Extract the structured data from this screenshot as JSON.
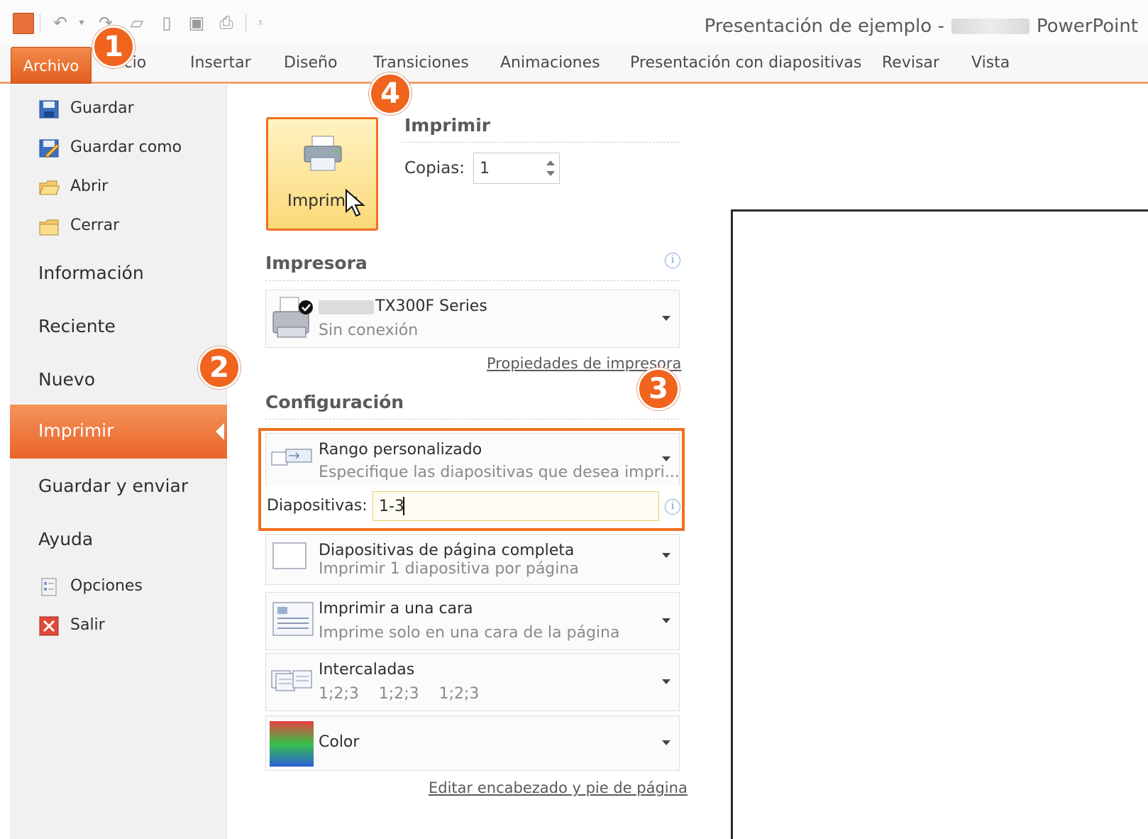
{
  "window": {
    "title_left": "Presentación de ejemplo  -",
    "title_right": "PowerPoint"
  },
  "ribbon": {
    "file_tab": "Archivo",
    "tabs": [
      "Inicio",
      "Insertar",
      "Diseño",
      "Transiciones",
      "Animaciones",
      "Presentación con diapositivas",
      "Revisar",
      "Vista"
    ]
  },
  "nav": {
    "save": "Guardar",
    "save_as": "Guardar como",
    "open": "Abrir",
    "close": "Cerrar",
    "info": "Información",
    "recent": "Reciente",
    "new": "Nuevo",
    "print": "Imprimir",
    "save_send": "Guardar y enviar",
    "help": "Ayuda",
    "options": "Opciones",
    "exit": "Salir"
  },
  "print": {
    "button_label": "Imprimir",
    "section_title": "Imprimir",
    "copies_label": "Copias:",
    "copies_value": "1"
  },
  "printer": {
    "section_title": "Impresora",
    "name": "TX300F Series",
    "status": "Sin conexión",
    "properties_link": "Propiedades de impresora"
  },
  "settings": {
    "section_title": "Configuración",
    "range_title": "Rango personalizado",
    "range_desc": "Especifique las diapositivas que desea impri...",
    "slides_label": "Diapositivas:",
    "slides_value": "1-3",
    "layout_title": "Diapositivas de página completa",
    "layout_desc": "Imprimir 1 diapositiva por página",
    "sides_title": "Imprimir a una cara",
    "sides_desc": "Imprime solo en una cara de la página",
    "collate_title": "Intercaladas",
    "collate_desc": "1;2;3    1;2;3    1;2;3",
    "color_title": "Color",
    "header_footer_link": "Editar encabezado y pie de página"
  },
  "callouts": [
    "1",
    "2",
    "3",
    "4"
  ],
  "colors": {
    "accent": "#f07020",
    "file_tab": "#e8642a",
    "print_button_bg": "#fbd979"
  }
}
